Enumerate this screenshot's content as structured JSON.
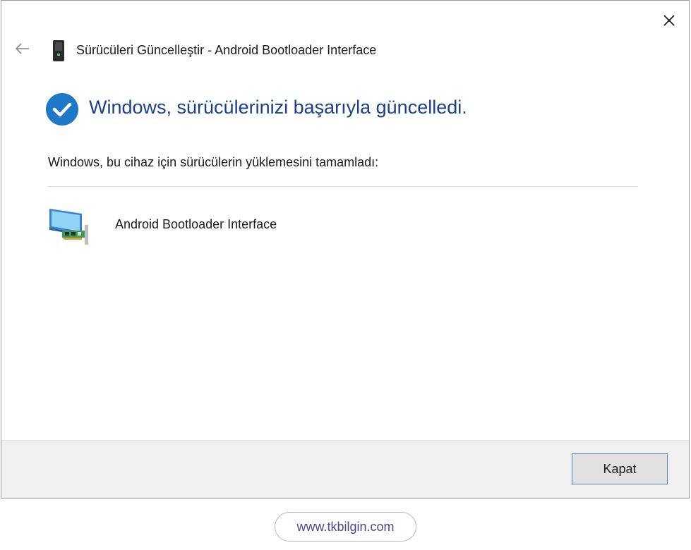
{
  "window": {
    "title": "Sürücüleri Güncelleştir - Android Bootloader Interface"
  },
  "icons": {
    "back": "back-arrow-icon",
    "close": "close-icon",
    "title": "usb-device-icon",
    "success": "checkmark-circle-icon",
    "device": "network-adapter-icon"
  },
  "content": {
    "heading": "Windows, sürücülerinizi başarıyla güncelledi.",
    "description": "Windows, bu cihaz için sürücülerin yüklemesini tamamladı:",
    "device_name": "Android Bootloader Interface"
  },
  "footer": {
    "close_label": "Kapat"
  },
  "watermark": {
    "text": "www.tkbilgin.com"
  },
  "colors": {
    "heading": "#1b3f8f",
    "success_circle": "#1e78c8",
    "button_border": "#4f86c6",
    "footer_bg": "#f0f0f0"
  }
}
